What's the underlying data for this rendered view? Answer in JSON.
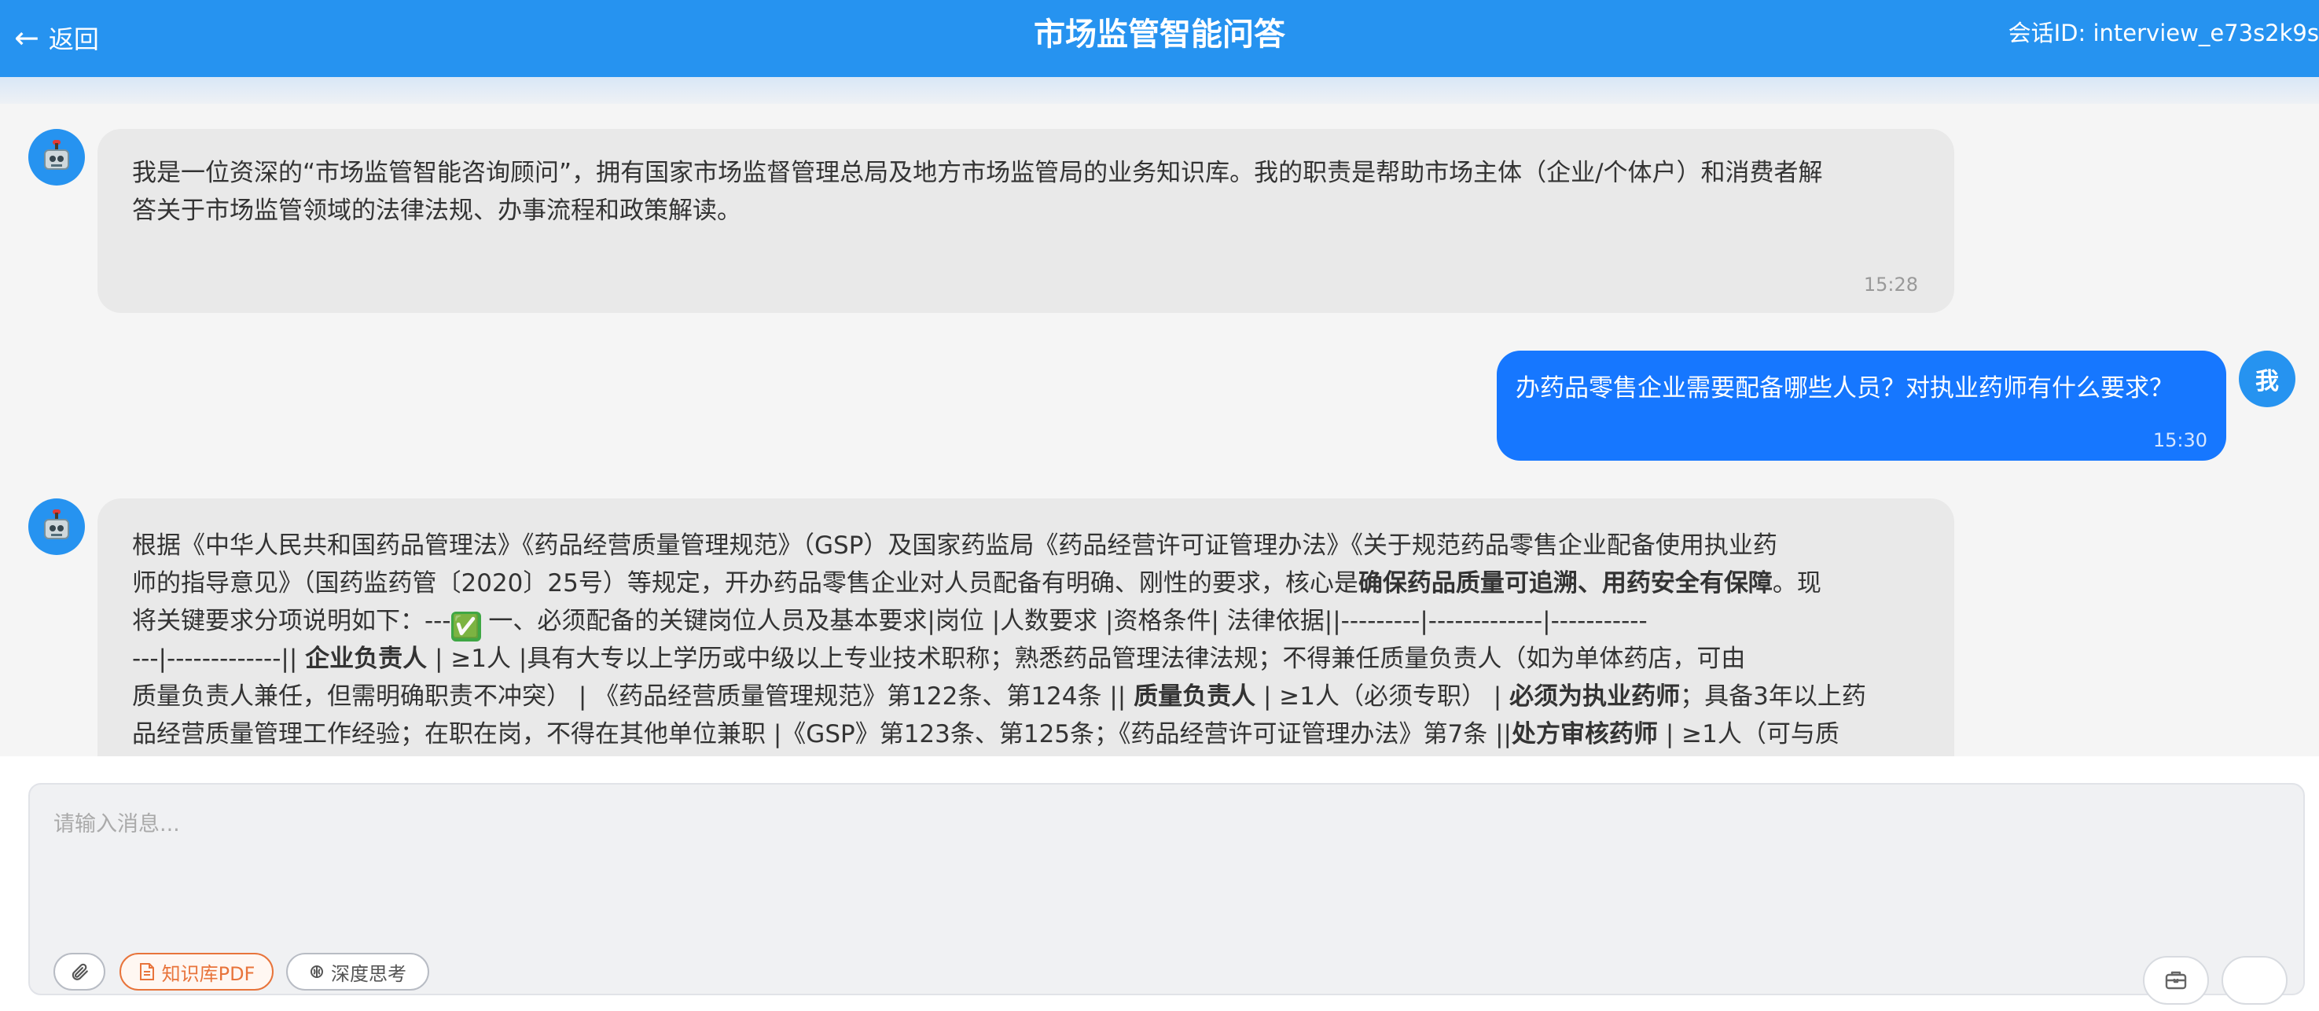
{
  "header": {
    "back_label": "返回",
    "title": "市场监管智能问答",
    "session_id": "会话ID: interview_e73s2k9s"
  },
  "messages": [
    {
      "role": "assistant",
      "lines": [
        "我是一位资深的“市场监管智能咨询顾问”，拥有国家市场监督管理总局及地方市场监管局的业务知识库。我的职责是帮助市场主体（企业/个体户）和消费者解",
        "答关于市场监管领域的法律法规、办事流程和政策解读。"
      ],
      "time": "15:28"
    },
    {
      "role": "user",
      "text": "办药品零售企业需要配备哪些人员？对执业药师有什么要求？",
      "avatar_label": "我",
      "time": "15:30"
    },
    {
      "role": "assistant",
      "line1": "根据《中华人民共和国药品管理法》《药品经营质量管理规范》（GSP）及国家药监局《药品经营许可证管理办法》《关于规范药品零售企业配备使用执业药",
      "line2_a": "师的指导意见》（国药监药管〔2020〕25号）等规定，开办药品零售企业对人员配备有明确、刚性的要求，核心是",
      "line2_b": "确保药品质量可追溯、用药安全有保障",
      "line2_c": "。现",
      "line3_a": "将关键要求分项说明如下：---",
      "line3_emoji": "✅",
      "line3_b": " 一、必须配备的关键岗位人员及基本要求|岗位 |人数要求 |资格条件| 法律依据||---------|-------------|-----------",
      "line4_a": "---|-------------|| ",
      "line4_b": "企业负责人",
      "line4_c": " | ≥1人 |具有大专以上学历或中级以上专业技术职称；熟悉药品管理法律法规；不得兼任质量负责人（如为单体药店，可由",
      "line5_a": "质量负责人兼任，但需明确职责不冲突） | 《药品经营质量管理规范》第122条、第124条 || ",
      "line5_b": "质量负责人",
      "line5_c": " | ≥1人（必须专职） | ",
      "line5_d": "必须为执业药师",
      "line5_e": "；具备3年以上药",
      "line6_a": "品经营质量管理工作经验；在职在岗，不得在其他单位兼职 |《GSP》第123条、第125条；《药品经营许可证管理办法》第7条 ||",
      "line6_b": "处方审核药师",
      "line6_c": " | ≥1人（可与质"
    }
  ],
  "composer": {
    "placeholder": "请输入消息...",
    "knowledge_pdf_label": "知识库PDF",
    "deep_think_label": "深度思考"
  },
  "colors": {
    "header_bg": "#2693f0",
    "user_bubble": "#1677ff",
    "bot_bubble": "#e9e9e9",
    "knowledge_pill": "#e8743b"
  }
}
